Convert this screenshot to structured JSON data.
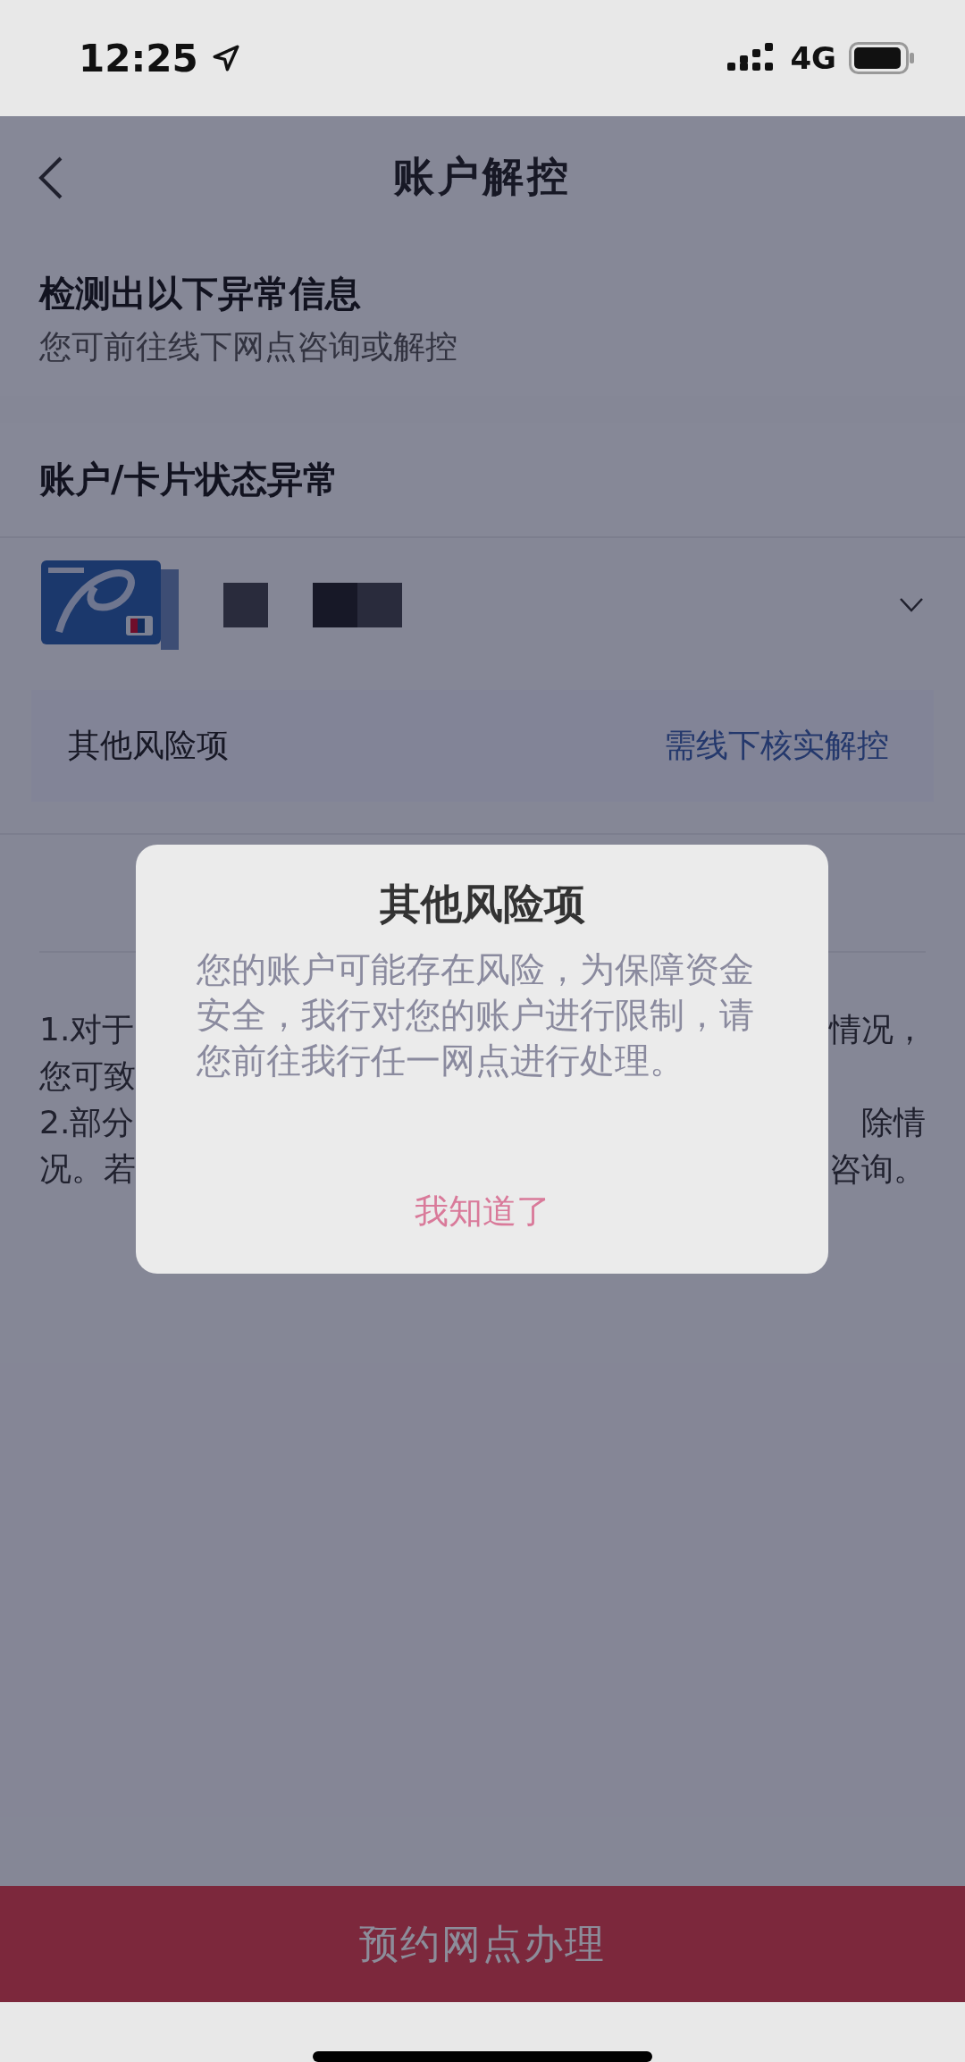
{
  "status_bar": {
    "time": "12:25",
    "network": "4G"
  },
  "nav": {
    "title": "账户解控"
  },
  "notice": {
    "title": "检测出以下异常信息",
    "subtitle": "您可前往线下网点咨询或解控"
  },
  "section": {
    "title": "账户/卡片状态异常"
  },
  "card": {
    "expanded": false
  },
  "risk": {
    "label": "其他风险项",
    "action": "需线下核实解控"
  },
  "notes": [
    {
      "left": "1.对于",
      "right": "情况，"
    },
    {
      "left": "您可致"
    },
    {
      "left": "2.部分",
      "right": "除情"
    },
    {
      "left": "况。若",
      "right": "咨询。"
    }
  ],
  "dialog": {
    "title": "其他风险项",
    "body": "您的账户可能存在风险，为保障资金安全，我行对您的账户进行限制，请您前往我行任一网点进行处理。",
    "button": "我知道了"
  },
  "bottom_button": {
    "label": "预约网点办理"
  }
}
